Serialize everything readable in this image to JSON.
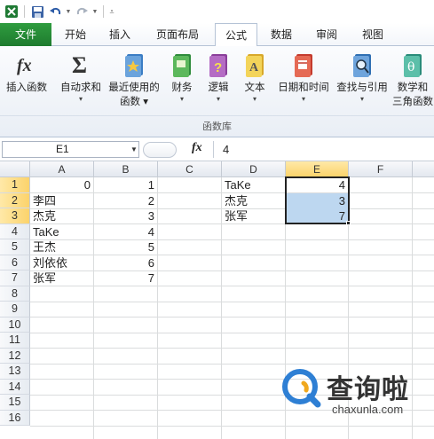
{
  "ribbon_tabs": [
    {
      "label": "文件"
    },
    {
      "label": "开始"
    },
    {
      "label": "插入"
    },
    {
      "label": "页面布局"
    },
    {
      "label": "公式"
    },
    {
      "label": "数据"
    },
    {
      "label": "审阅"
    },
    {
      "label": "视图"
    }
  ],
  "active_tab": "公式",
  "ribbon": {
    "buttons": [
      {
        "line1": "插入函数",
        "line2": "",
        "icon": "fx-icon"
      },
      {
        "line1": "自动求和",
        "line2": "▾",
        "icon": "sigma-icon"
      },
      {
        "line1": "最近使用的",
        "line2": "函数 ▾",
        "icon": "recent-book-icon"
      },
      {
        "line1": "财务",
        "line2": "▾",
        "icon": "finance-book-icon"
      },
      {
        "line1": "逻辑",
        "line2": "▾",
        "icon": "logic-book-icon"
      },
      {
        "line1": "文本",
        "line2": "▾",
        "icon": "text-book-icon"
      },
      {
        "line1": "日期和时间",
        "line2": "▾",
        "icon": "datetime-book-icon"
      },
      {
        "line1": "查找与引用",
        "line2": "▾",
        "icon": "lookup-book-icon"
      },
      {
        "line1": "数学和",
        "line2": "三角函数",
        "icon": "math-book-icon"
      }
    ],
    "group_label": "函数库"
  },
  "formula_bar": {
    "name_box": "E1",
    "fx_label": "fx",
    "formula": "4"
  },
  "columns": [
    "A",
    "B",
    "C",
    "D",
    "E",
    "F"
  ],
  "rows": [
    "1",
    "2",
    "3",
    "4",
    "5",
    "6",
    "7",
    "8",
    "9",
    "10",
    "11",
    "12",
    "13",
    "14",
    "15",
    "16"
  ],
  "cells": {
    "A1": "0",
    "B1": "1",
    "D1": "TaKe",
    "E1": "4",
    "A2": "李四",
    "B2": "2",
    "D2": "杰克",
    "E2": "3",
    "A3": "杰克",
    "B3": "3",
    "D3": "张军",
    "E3": "7",
    "A4": "TaKe",
    "B4": "4",
    "A5": "王杰",
    "B5": "5",
    "A6": "刘依依",
    "B6": "6",
    "A7": "张军",
    "B7": "7"
  },
  "watermark": {
    "title": "查询啦",
    "url": "chaxunla.com"
  }
}
